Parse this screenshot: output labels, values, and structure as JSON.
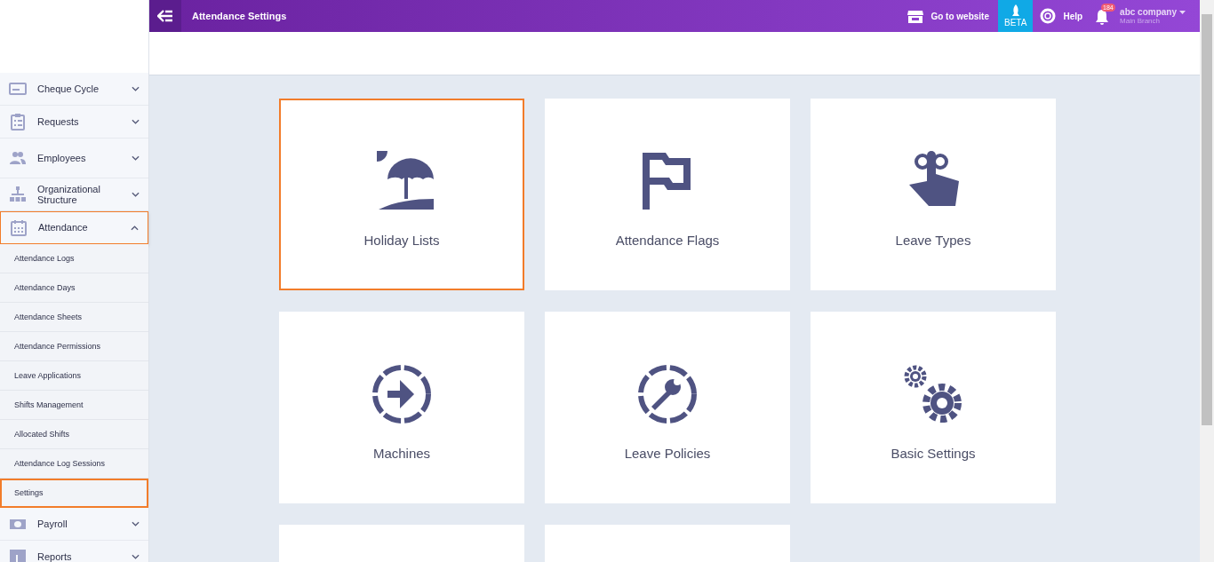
{
  "topbar": {
    "title": "Attendance Settings",
    "website_link": "Go to website",
    "beta": "BETA",
    "help": "Help",
    "notifications": "184",
    "company": "abc company",
    "branch": "Main Branch"
  },
  "sidebar": {
    "items": [
      {
        "label": "Cheque Cycle",
        "kind": "cheque",
        "expanded": false,
        "selected": false
      },
      {
        "label": "Requests",
        "kind": "clipboard",
        "expanded": false,
        "selected": false
      },
      {
        "label": "Employees",
        "kind": "people",
        "expanded": false,
        "selected": false
      },
      {
        "label": "Organizational Structure",
        "kind": "org",
        "expanded": false,
        "selected": false
      },
      {
        "label": "Attendance",
        "kind": "calendar",
        "expanded": true,
        "selected": true,
        "children": [
          {
            "label": "Attendance Logs",
            "selected": false
          },
          {
            "label": "Attendance Days",
            "selected": false
          },
          {
            "label": "Attendance Sheets",
            "selected": false
          },
          {
            "label": "Attendance Permissions",
            "selected": false
          },
          {
            "label": "Leave Applications",
            "selected": false
          },
          {
            "label": "Shifts Management",
            "selected": false
          },
          {
            "label": "Allocated Shifts",
            "selected": false
          },
          {
            "label": "Attendance Log Sessions",
            "selected": false
          },
          {
            "label": "Settings",
            "selected": true
          }
        ]
      },
      {
        "label": "Payroll",
        "kind": "money",
        "expanded": false,
        "selected": false
      },
      {
        "label": "Reports",
        "kind": "chart",
        "expanded": false,
        "selected": false
      }
    ]
  },
  "cards": [
    {
      "label": "Holiday Lists",
      "kind": "umbrella",
      "selected": true
    },
    {
      "label": "Attendance Flags",
      "kind": "flag",
      "selected": false
    },
    {
      "label": "Leave Types",
      "kind": "finger",
      "selected": false
    },
    {
      "label": "Machines",
      "kind": "enter",
      "selected": false
    },
    {
      "label": "Leave Policies",
      "kind": "wrench",
      "selected": false
    },
    {
      "label": "Basic Settings",
      "kind": "gears",
      "selected": false
    },
    {
      "kind": "blank",
      "selected": false
    },
    {
      "kind": "blank",
      "selected": false
    }
  ]
}
